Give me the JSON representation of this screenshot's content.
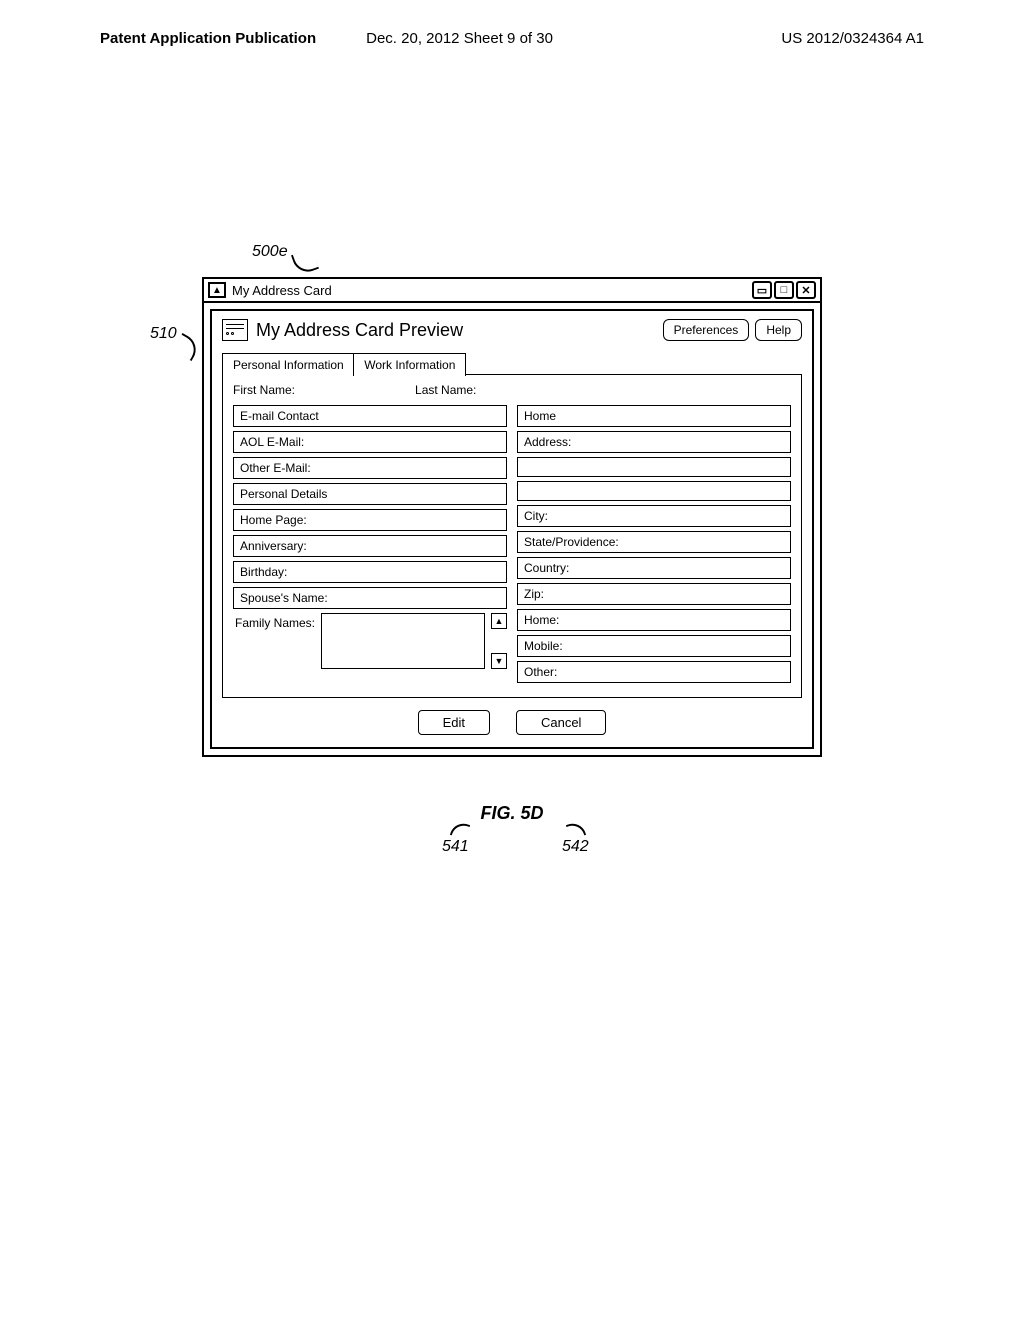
{
  "page_header": {
    "left": "Patent Application Publication",
    "mid": "Dec. 20, 2012  Sheet 9 of 30",
    "right": "US 2012/0324364 A1"
  },
  "refs": {
    "r500e": "500e",
    "r510": "510",
    "r541": "541",
    "r542": "542"
  },
  "figure_caption": "FIG. 5D",
  "window": {
    "title": "My Address Card",
    "panel_title": "My Address Card Preview",
    "preferences": "Preferences",
    "help": "Help",
    "tabs": {
      "personal": "Personal Information",
      "work": "Work Information"
    },
    "names": {
      "first": "First Name:",
      "last": "Last Name:"
    },
    "left_fields": {
      "email_contact": "E-mail Contact",
      "aol_email": "AOL E-Mail:",
      "other_email": "Other E-Mail:",
      "personal_details": "Personal Details",
      "home_page": "Home Page:",
      "anniversary": "Anniversary:",
      "birthday": "Birthday:",
      "spouse": "Spouse's Name:",
      "family": "Family Names:"
    },
    "right_fields": {
      "home_hdr": "Home",
      "address": "Address:",
      "blank1": "",
      "blank2": "",
      "city": "City:",
      "state": "State/Providence:",
      "country": "Country:",
      "zip": "Zip:",
      "home_phone": "Home:",
      "mobile": "Mobile:",
      "other": "Other:"
    },
    "buttons": {
      "edit": "Edit",
      "cancel": "Cancel"
    }
  }
}
